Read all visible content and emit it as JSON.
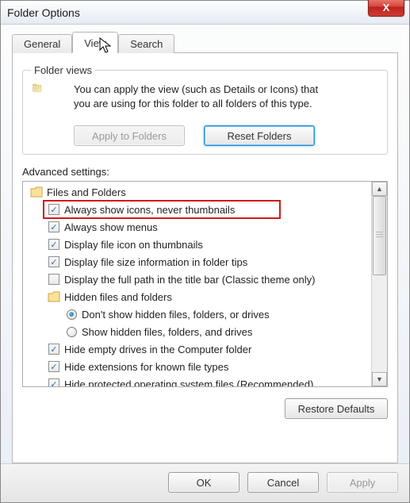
{
  "window": {
    "title": "Folder Options"
  },
  "close_btn": {
    "glyph": "X"
  },
  "tabs": [
    {
      "label": "General",
      "active": false
    },
    {
      "label": "View",
      "active": true
    },
    {
      "label": "Search",
      "active": false
    }
  ],
  "folder_views": {
    "legend": "Folder views",
    "text_line1": "You can apply the view (such as Details or Icons) that",
    "text_line2": "you are using for this folder to all folders of this type.",
    "apply_label": "Apply to Folders",
    "reset_label": "Reset Folders"
  },
  "advanced": {
    "label": "Advanced settings:",
    "root_label": "Files and Folders",
    "items": [
      {
        "type": "check",
        "checked": true,
        "label": "Always show icons, never thumbnails",
        "highlighted": true
      },
      {
        "type": "check",
        "checked": true,
        "label": "Always show menus"
      },
      {
        "type": "check",
        "checked": true,
        "label": "Display file icon on thumbnails"
      },
      {
        "type": "check",
        "checked": true,
        "label": "Display file size information in folder tips"
      },
      {
        "type": "check",
        "checked": false,
        "label": "Display the full path in the title bar (Classic theme only)"
      },
      {
        "type": "group",
        "label": "Hidden files and folders",
        "children": [
          {
            "type": "radio",
            "checked": true,
            "label": "Don't show hidden files, folders, or drives"
          },
          {
            "type": "radio",
            "checked": false,
            "label": "Show hidden files, folders, and drives"
          }
        ]
      },
      {
        "type": "check",
        "checked": true,
        "label": "Hide empty drives in the Computer folder"
      },
      {
        "type": "check",
        "checked": true,
        "label": "Hide extensions for known file types"
      },
      {
        "type": "check",
        "checked": true,
        "label": "Hide protected operating system files (Recommended)"
      }
    ],
    "restore_label": "Restore Defaults"
  },
  "footer": {
    "ok": "OK",
    "cancel": "Cancel",
    "apply": "Apply"
  }
}
